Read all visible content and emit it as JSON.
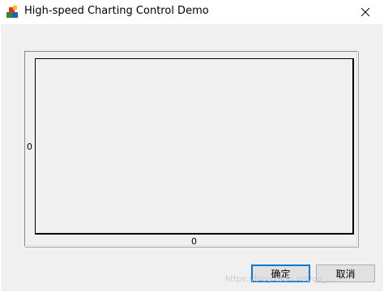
{
  "window": {
    "title": "High-speed Charting Control Demo",
    "icons": {
      "app": "app-icon",
      "close": "close-icon"
    }
  },
  "chart": {
    "y_axis_label": "0",
    "x_axis_label": "0"
  },
  "buttons": {
    "ok_label": "确定",
    "cancel_label": "取消"
  },
  "watermark": "https://blog.csdn.net/qq_...",
  "colors": {
    "client_background": "#f0f0f0",
    "default_button_border": "#0078d7",
    "plot_border": "#000000"
  }
}
